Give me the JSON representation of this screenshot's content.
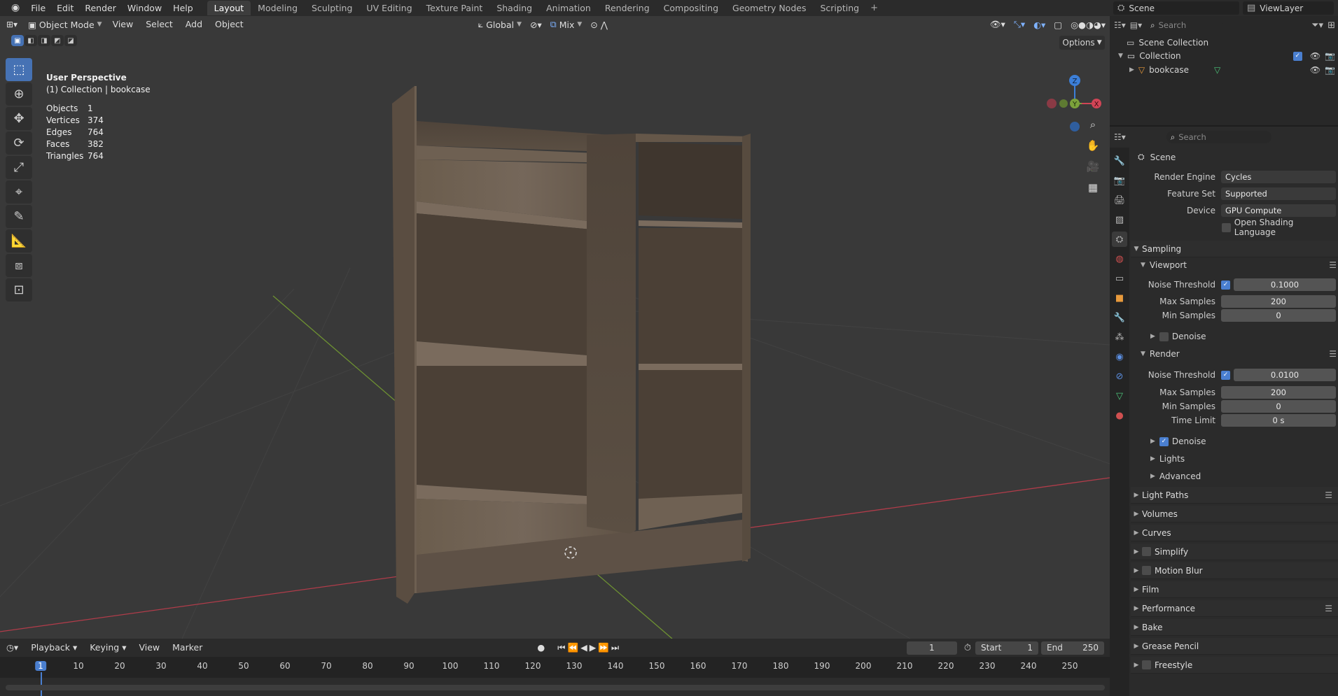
{
  "topbar": {
    "menu": [
      "File",
      "Edit",
      "Render",
      "Window",
      "Help"
    ],
    "tabs": [
      "Layout",
      "Modeling",
      "Sculpting",
      "UV Editing",
      "Texture Paint",
      "Shading",
      "Animation",
      "Rendering",
      "Compositing",
      "Geometry Nodes",
      "Scripting"
    ],
    "active_tab": "Layout",
    "scene": "Scene",
    "view_layer": "ViewLayer"
  },
  "viewport": {
    "mode": "Object Mode",
    "menu": [
      "View",
      "Select",
      "Add",
      "Object"
    ],
    "transform": "Global",
    "pivot": "Mix",
    "options": "Options",
    "perspective": "User Perspective",
    "context": "(1) Collection | bookcase",
    "stats": [
      {
        "label": "Objects",
        "value": "1"
      },
      {
        "label": "Vertices",
        "value": "374"
      },
      {
        "label": "Edges",
        "value": "764"
      },
      {
        "label": "Faces",
        "value": "382"
      },
      {
        "label": "Triangles",
        "value": "764"
      }
    ],
    "gizmo_axes": [
      "Z",
      "Y",
      "X"
    ]
  },
  "outliner": {
    "search_placeholder": "Search",
    "scene_collection": "Scene Collection",
    "collection": "Collection",
    "object": "bookcase"
  },
  "properties": {
    "search_placeholder": "Search",
    "context": "Scene",
    "render_engine_label": "Render Engine",
    "render_engine": "Cycles",
    "feature_set_label": "Feature Set",
    "feature_set": "Supported",
    "device_label": "Device",
    "device": "GPU Compute",
    "osl": "Open Shading Language",
    "sampling": "Sampling",
    "viewport": "Viewport",
    "noise_threshold_label": "Noise Threshold",
    "vp_noise_threshold": "0.1000",
    "max_samples_label": "Max Samples",
    "vp_max_samples": "200",
    "min_samples_label": "Min Samples",
    "vp_min_samples": "0",
    "denoise": "Denoise",
    "render": "Render",
    "r_noise_threshold": "0.0100",
    "r_max_samples": "200",
    "r_min_samples": "0",
    "time_limit_label": "Time Limit",
    "r_time_limit": "0 s",
    "lights": "Lights",
    "advanced": "Advanced",
    "panels": [
      "Light Paths",
      "Volumes",
      "Curves",
      "Simplify",
      "Motion Blur",
      "Film",
      "Performance",
      "Bake",
      "Grease Pencil",
      "Freestyle"
    ]
  },
  "timeline": {
    "menu": [
      "Playback",
      "Keying",
      "View",
      "Marker"
    ],
    "current_frame": "1",
    "start_label": "Start",
    "start": "1",
    "end_label": "End",
    "end": "250",
    "ruler": [
      "1",
      "10",
      "20",
      "30",
      "40",
      "50",
      "60",
      "70",
      "80",
      "90",
      "100",
      "110",
      "120",
      "130",
      "140",
      "150",
      "160",
      "170",
      "180",
      "190",
      "200",
      "210",
      "220",
      "230",
      "240",
      "250"
    ]
  },
  "colors": {
    "accent": "#4a7fd0",
    "x_axis": "#d04556",
    "y_axis": "#7ca23b",
    "z_axis": "#3c7fd8"
  }
}
